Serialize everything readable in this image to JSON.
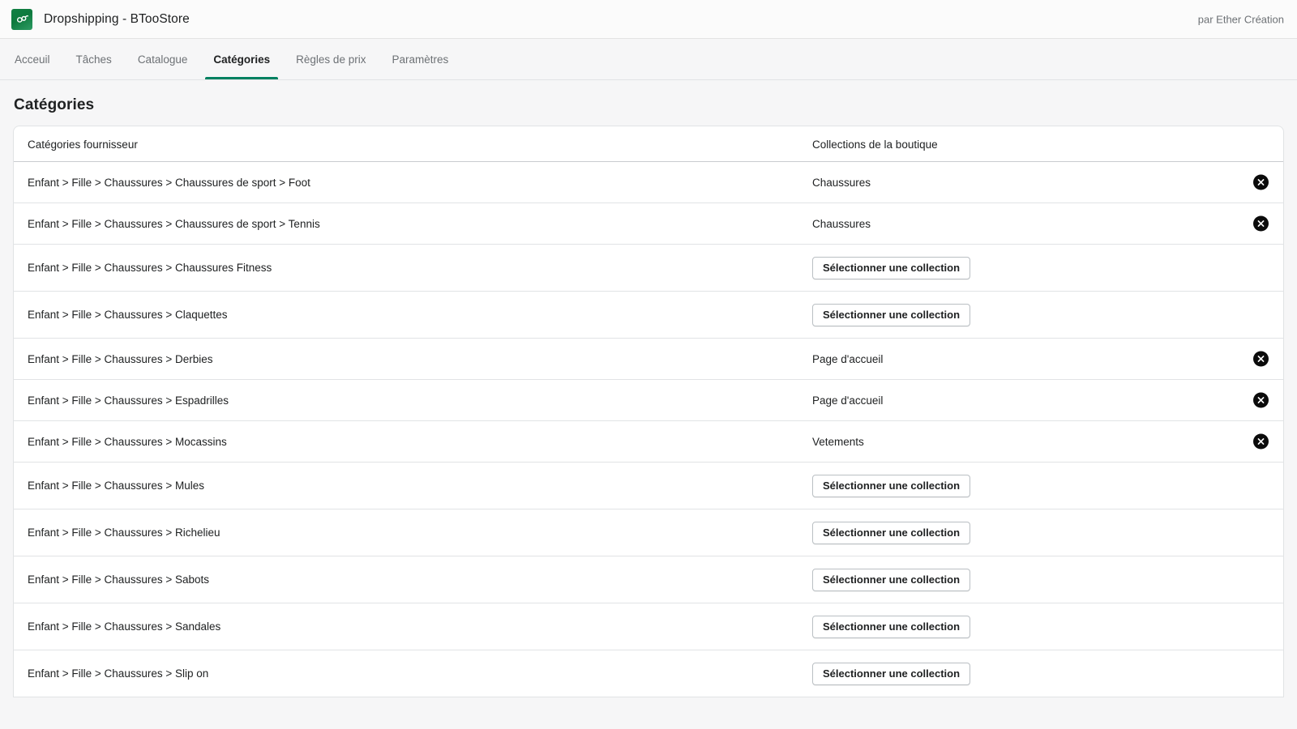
{
  "app": {
    "logo_icon": "infinity-loop-icon",
    "logo_color": "#108043",
    "title": "Dropshipping - BTooStore",
    "byline": "par Ether Création"
  },
  "nav": {
    "active_index": 3,
    "accent_color": "#008060",
    "tabs": [
      {
        "label": "Acceuil"
      },
      {
        "label": "Tâches"
      },
      {
        "label": "Catalogue"
      },
      {
        "label": "Catégories"
      },
      {
        "label": "Règles de prix"
      },
      {
        "label": "Paramètres"
      }
    ]
  },
  "page": {
    "title": "Catégories"
  },
  "table": {
    "columns": {
      "supplier_categories": "Catégories fournisseur",
      "store_collections": "Collections de la boutique"
    },
    "select_button_label": "Sélectionner une collection",
    "remove_icon": "circle-x-icon",
    "rows": [
      {
        "category": "Enfant > Fille > Chaussures > Chaussures de sport > Foot",
        "collection": "Chaussures",
        "has_collection": true
      },
      {
        "category": "Enfant > Fille > Chaussures > Chaussures de sport > Tennis",
        "collection": "Chaussures",
        "has_collection": true
      },
      {
        "category": "Enfant > Fille > Chaussures > Chaussures Fitness",
        "collection": null,
        "has_collection": false
      },
      {
        "category": "Enfant > Fille > Chaussures > Claquettes",
        "collection": null,
        "has_collection": false
      },
      {
        "category": "Enfant > Fille > Chaussures > Derbies",
        "collection": "Page d'accueil",
        "has_collection": true
      },
      {
        "category": "Enfant > Fille > Chaussures > Espadrilles",
        "collection": "Page d'accueil",
        "has_collection": true
      },
      {
        "category": "Enfant > Fille > Chaussures > Mocassins",
        "collection": "Vetements",
        "has_collection": true
      },
      {
        "category": "Enfant > Fille > Chaussures > Mules",
        "collection": null,
        "has_collection": false
      },
      {
        "category": "Enfant > Fille > Chaussures > Richelieu",
        "collection": null,
        "has_collection": false
      },
      {
        "category": "Enfant > Fille > Chaussures > Sabots",
        "collection": null,
        "has_collection": false
      },
      {
        "category": "Enfant > Fille > Chaussures > Sandales",
        "collection": null,
        "has_collection": false
      },
      {
        "category": "Enfant > Fille > Chaussures > Slip on",
        "collection": null,
        "has_collection": false
      }
    ]
  }
}
